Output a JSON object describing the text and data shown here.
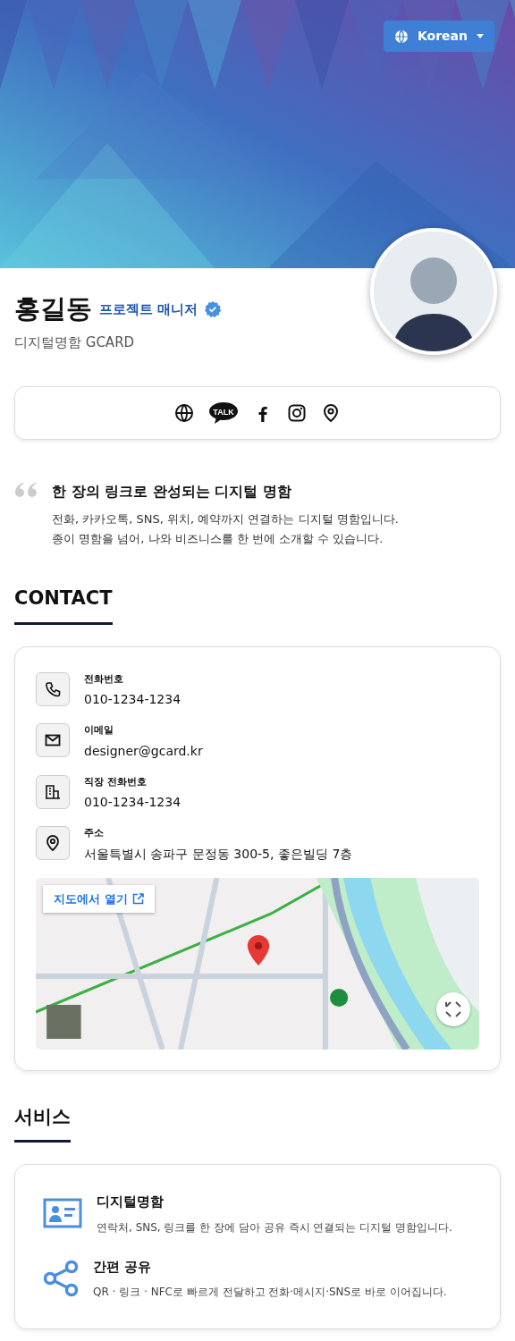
{
  "header": {
    "language_button": "Korean"
  },
  "profile": {
    "name": "홍길동",
    "title": "프로젝트 매니저",
    "verified": true,
    "subtitle": "디지털명함 GCARD"
  },
  "social_links": [
    {
      "kind": "web"
    },
    {
      "kind": "talk",
      "label": "TALK"
    },
    {
      "kind": "facebook"
    },
    {
      "kind": "instagram"
    },
    {
      "kind": "location"
    }
  ],
  "intro": {
    "heading": "한 장의 링크로 완성되는 디지털 명함",
    "lines": [
      "전화, 카카오톡, SNS, 위치, 예약까지 연결하는 디지털 명함입니다.",
      "종이 명함을 넘어, 나와 비즈니스를 한 번에 소개할 수 있습니다."
    ]
  },
  "contact": {
    "title": "CONTACT",
    "items": [
      {
        "kind": "phone",
        "label": "전화번호",
        "value": "010-1234-1234"
      },
      {
        "kind": "email",
        "label": "이메일",
        "value": "designer@gcard.kr"
      },
      {
        "kind": "office",
        "label": "직장 전화번호",
        "value": "010-1234-1234"
      },
      {
        "kind": "address",
        "label": "주소",
        "value": "서울특별시 송파구 문정동 300-5, 좋은빌딩 7층"
      }
    ],
    "map": {
      "open_button": "지도에서 열기"
    }
  },
  "services": {
    "title": "서비스",
    "items": [
      {
        "kind": "card",
        "title": "디지털명함",
        "description": "연락처, SNS, 링크를 한 장에 담아 공유 즉시 연결되는 디지털 명함입니다."
      },
      {
        "kind": "share",
        "title": "간편 공유",
        "description": "QR · 링크 · NFC로 빠르게 전달하고 전화·메시지·SNS로 바로 이어집니다."
      }
    ]
  }
}
